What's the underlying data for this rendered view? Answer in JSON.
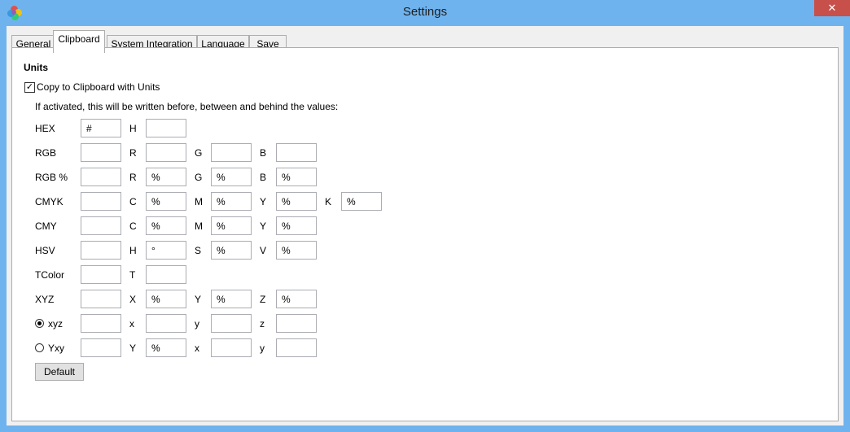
{
  "window": {
    "title": "Settings",
    "close_glyph": "✕",
    "app_icon": "flower-icon"
  },
  "tabs": [
    {
      "label": "General"
    },
    {
      "label": "Clipboard",
      "active": true
    },
    {
      "label": "System Integration"
    },
    {
      "label": "Language"
    },
    {
      "label": "Save"
    }
  ],
  "units": {
    "heading": "Units",
    "copy_checkbox": {
      "label": "Copy to Clipboard with Units",
      "checked": true
    },
    "description": "If activated, this will be written before, between and behind the values:",
    "rows": [
      {
        "name": "HEX",
        "prefix": "#",
        "fields": [
          {
            "label": "H",
            "value": ""
          }
        ]
      },
      {
        "name": "RGB",
        "prefix": "",
        "fields": [
          {
            "label": "R",
            "value": ""
          },
          {
            "label": "G",
            "value": ""
          },
          {
            "label": "B",
            "value": ""
          }
        ]
      },
      {
        "name": "RGB %",
        "prefix": "",
        "fields": [
          {
            "label": "R",
            "value": "%"
          },
          {
            "label": "G",
            "value": "%"
          },
          {
            "label": "B",
            "value": "%"
          }
        ]
      },
      {
        "name": "CMYK",
        "prefix": "",
        "fields": [
          {
            "label": "C",
            "value": "%"
          },
          {
            "label": "M",
            "value": "%"
          },
          {
            "label": "Y",
            "value": "%"
          },
          {
            "label": "K",
            "value": "%"
          }
        ]
      },
      {
        "name": "CMY",
        "prefix": "",
        "fields": [
          {
            "label": "C",
            "value": "%"
          },
          {
            "label": "M",
            "value": "%"
          },
          {
            "label": "Y",
            "value": "%"
          }
        ]
      },
      {
        "name": "HSV",
        "prefix": "",
        "fields": [
          {
            "label": "H",
            "value": "°"
          },
          {
            "label": "S",
            "value": "%"
          },
          {
            "label": "V",
            "value": "%"
          }
        ]
      },
      {
        "name": "TColor",
        "prefix": "",
        "fields": [
          {
            "label": "T",
            "value": ""
          }
        ]
      },
      {
        "name": "XYZ",
        "prefix": "",
        "fields": [
          {
            "label": "X",
            "value": "%"
          },
          {
            "label": "Y",
            "value": "%"
          },
          {
            "label": "Z",
            "value": "%"
          }
        ]
      },
      {
        "name": "xyz",
        "prefix": "",
        "radio": true,
        "selected": true,
        "fields": [
          {
            "label": "x",
            "value": ""
          },
          {
            "label": "y",
            "value": ""
          },
          {
            "label": "z",
            "value": ""
          }
        ]
      },
      {
        "name": "Yxy",
        "prefix": "",
        "radio": true,
        "selected": false,
        "fields": [
          {
            "label": "Y",
            "value": "%"
          },
          {
            "label": "x",
            "value": ""
          },
          {
            "label": "y",
            "value": ""
          }
        ]
      }
    ],
    "default_button": "Default"
  },
  "colors": {
    "window_frame": "#6fb3ee",
    "close_button": "#c7504b",
    "panel": "#ffffff"
  }
}
